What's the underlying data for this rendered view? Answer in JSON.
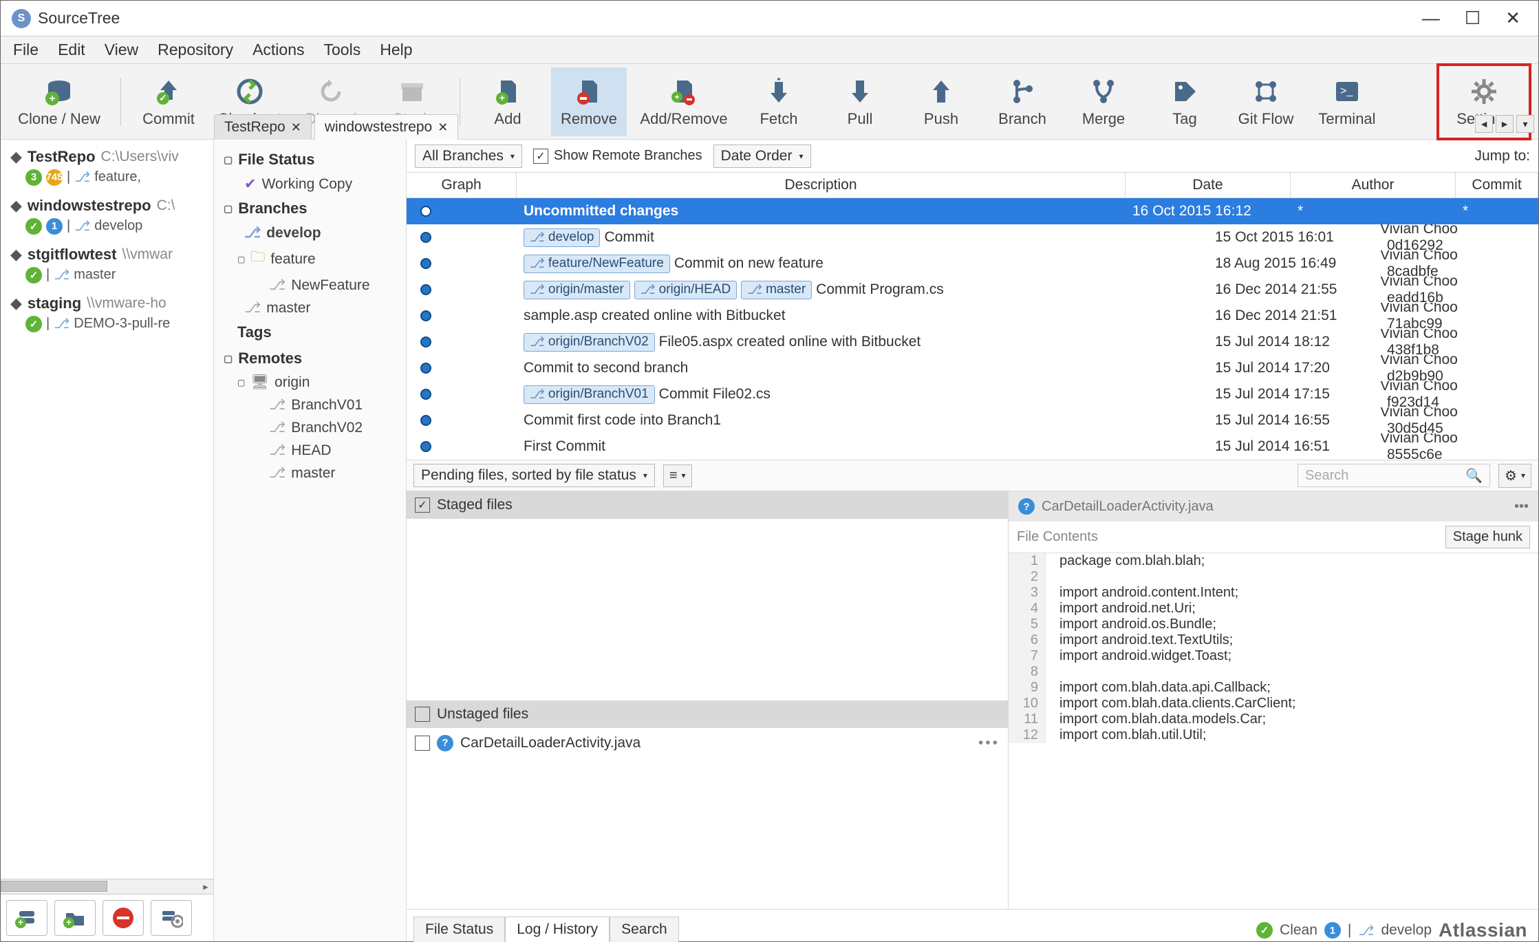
{
  "window": {
    "title": "SourceTree"
  },
  "menu": [
    "File",
    "Edit",
    "View",
    "Repository",
    "Actions",
    "Tools",
    "Help"
  ],
  "toolbar": [
    {
      "id": "clone",
      "label": "Clone / New",
      "icon": "db-plus"
    },
    {
      "id": "commit",
      "label": "Commit",
      "icon": "up"
    },
    {
      "id": "checkout",
      "label": "Checkout",
      "icon": "swap"
    },
    {
      "id": "discard",
      "label": "Discard",
      "icon": "undo",
      "disabled": true
    },
    {
      "id": "stash",
      "label": "Stash",
      "icon": "box",
      "disabled": true
    },
    {
      "id": "add",
      "label": "Add",
      "icon": "page-plus"
    },
    {
      "id": "remove",
      "label": "Remove",
      "icon": "page-minus",
      "active": true
    },
    {
      "id": "addremove",
      "label": "Add/Remove",
      "icon": "page-plusminus"
    },
    {
      "id": "fetch",
      "label": "Fetch",
      "icon": "down-dashed"
    },
    {
      "id": "pull",
      "label": "Pull",
      "icon": "down"
    },
    {
      "id": "push",
      "label": "Push",
      "icon": "up-arrow"
    },
    {
      "id": "branch",
      "label": "Branch",
      "icon": "branch"
    },
    {
      "id": "merge",
      "label": "Merge",
      "icon": "merge"
    },
    {
      "id": "tag",
      "label": "Tag",
      "icon": "tag"
    },
    {
      "id": "gitflow",
      "label": "Git Flow",
      "icon": "flow"
    },
    {
      "id": "terminal",
      "label": "Terminal",
      "icon": "terminal"
    },
    {
      "id": "settings",
      "label": "Settings",
      "icon": "gear",
      "highlight": true
    }
  ],
  "repos": [
    {
      "name": "TestRepo",
      "path": "C:\\Users\\viv",
      "badges": [
        {
          "cls": "c-green",
          "t": "3"
        },
        {
          "cls": "c-yellow",
          "t": "745"
        }
      ],
      "branch": "feature,"
    },
    {
      "name": "windowstestrepo",
      "path": "C:\\",
      "badges": [
        {
          "cls": "c-check",
          "t": "✓"
        },
        {
          "cls": "c-blue",
          "t": "1"
        }
      ],
      "branch": "develop"
    },
    {
      "name": "stgitflowtest",
      "path": "\\\\vmwar",
      "badges": [
        {
          "cls": "c-check",
          "t": "✓"
        }
      ],
      "branch": "master"
    },
    {
      "name": "staging",
      "path": "\\\\vmware-ho",
      "badges": [
        {
          "cls": "c-check",
          "t": "✓"
        }
      ],
      "branch": "DEMO-3-pull-re"
    }
  ],
  "tabs": [
    {
      "label": "TestRepo"
    },
    {
      "label": "windowstestrepo"
    }
  ],
  "tree": {
    "filestatus": "File Status",
    "working": "Working Copy",
    "branches": "Branches",
    "develop": "develop",
    "feature": "feature",
    "newfeature": "NewFeature",
    "master": "master",
    "tags": "Tags",
    "remotes": "Remotes",
    "origin": "origin",
    "r_branchv01": "BranchV01",
    "r_branchv02": "BranchV02",
    "r_head": "HEAD",
    "r_master": "master"
  },
  "filter": {
    "branches": "All Branches",
    "remote_chk": "Show Remote Branches",
    "order": "Date Order",
    "jump": "Jump to:"
  },
  "columns": {
    "graph": "Graph",
    "desc": "Description",
    "date": "Date",
    "auth": "Author",
    "comm": "Commit"
  },
  "commits": [
    {
      "sel": true,
      "open": true,
      "desc": "Uncommitted changes",
      "date": "16 Oct 2015 16:12",
      "auth": "*",
      "comm": "*",
      "tags": []
    },
    {
      "desc": "Commit",
      "date": "15 Oct 2015 16:01",
      "auth": "Vivian Choo <vchc",
      "comm": "0d16292",
      "tags": [
        "develop"
      ]
    },
    {
      "desc": "Commit on new feature",
      "date": "18 Aug 2015 16:49",
      "auth": "Vivian Choo <vchc",
      "comm": "8cadbfe",
      "tags": [
        "feature/NewFeature"
      ]
    },
    {
      "desc": "Commit Program.cs",
      "date": "16 Dec 2014 21:55",
      "auth": "Vivian Choo <vchc",
      "comm": "eadd16b",
      "tags": [
        "origin/master",
        "origin/HEAD",
        "master"
      ]
    },
    {
      "desc": "sample.asp created online with Bitbucket",
      "date": "16 Dec 2014 21:51",
      "auth": "Vivian Choo <vchc",
      "comm": "71abc99",
      "tags": []
    },
    {
      "desc": "File05.aspx created online with Bitbucket",
      "date": "15 Jul 2014 18:12",
      "auth": "Vivian Choo <vchc",
      "comm": "438f1b8",
      "tags": [
        "origin/BranchV02"
      ]
    },
    {
      "desc": "Commit to second branch",
      "date": "15 Jul 2014 17:20",
      "auth": "Vivian Choo <vchc",
      "comm": "d2b9b90",
      "tags": []
    },
    {
      "desc": "Commit File02.cs",
      "date": "15 Jul 2014 17:15",
      "auth": "Vivian Choo <vchc",
      "comm": "f923d14",
      "tags": [
        "origin/BranchV01"
      ]
    },
    {
      "desc": "Commit first code into Branch1",
      "date": "15 Jul 2014 16:55",
      "auth": "Vivian Choo <vchc",
      "comm": "30d5d45",
      "tags": []
    },
    {
      "desc": "First Commit",
      "date": "15 Jul 2014 16:51",
      "auth": "Vivian Choo <vchc",
      "comm": "8555c6e",
      "tags": []
    }
  ],
  "mid": {
    "pending": "Pending files, sorted by file status",
    "search_ph": "Search",
    "staged": "Staged files",
    "unstaged": "Unstaged files",
    "file": "CarDetailLoaderActivity.java"
  },
  "diff": {
    "title": "CarDetailLoaderActivity.java",
    "sub": "File Contents",
    "hunk": "Stage hunk",
    "lines": [
      "package com.blah.blah;",
      "",
      "import android.content.Intent;",
      "import android.net.Uri;",
      "import android.os.Bundle;",
      "import android.text.TextUtils;",
      "import android.widget.Toast;",
      "",
      "import com.blah.data.api.Callback;",
      "import com.blah.data.clients.CarClient;",
      "import com.blah.data.models.Car;",
      "import com.blah.util.Util;"
    ]
  },
  "bottomtabs": [
    "File Status",
    "Log / History",
    "Search"
  ],
  "status": {
    "clean": "Clean",
    "count": "1",
    "branch": "develop",
    "brand": "Atlassian"
  }
}
